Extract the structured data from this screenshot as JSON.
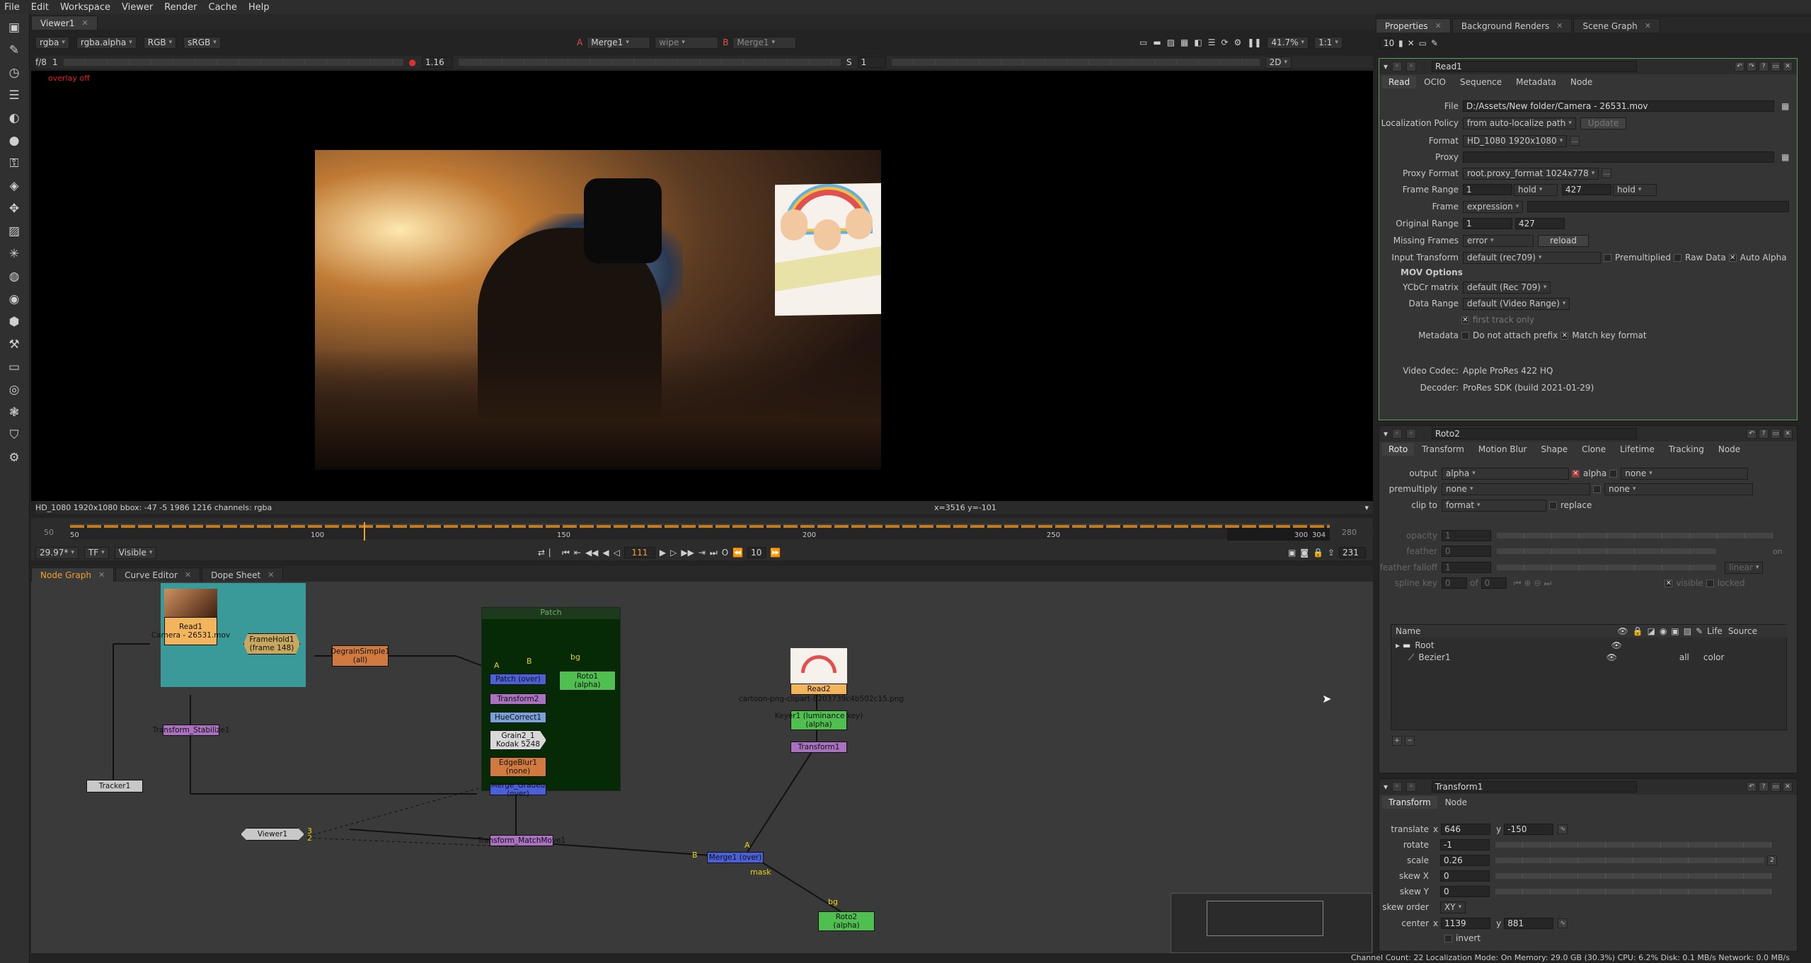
{
  "menu": [
    "File",
    "Edit",
    "Workspace",
    "Viewer",
    "Render",
    "Cache",
    "Help"
  ],
  "viewer": {
    "tab": "Viewer1",
    "channels": "rgba",
    "alpha": "rgba.alpha",
    "colorspace_rgb": "RGB",
    "display": "sRGB",
    "input_a_label": "A",
    "input_a": "Merge1",
    "wipe": "wipe",
    "input_b_label": "B",
    "input_b": "Merge1",
    "zoom": "41.7%",
    "ratio": "1:1",
    "fstop": "f/8",
    "frame_ind": "1",
    "gain": "1.16",
    "s_label": "S",
    "s_value": "1",
    "view_mode": "2D",
    "overlay": "overlay off",
    "info_left": "HD_1080 1920x1080  bbox: -47 -5 1986 1216 channels: rgba",
    "info_coords": "x=3516 y=-101",
    "viewer_label_1": "Camera - 26531.mov"
  },
  "timeline": {
    "start": "50",
    "end": "280",
    "ticks": [
      "50",
      "100",
      "150",
      "200",
      "250",
      "300",
      "304"
    ],
    "current": "111",
    "fps": "29.97*",
    "tf": "TF",
    "visible": "Visible",
    "increment": "10",
    "end_frame": "231"
  },
  "nodegraph": {
    "tabs": [
      "Node Graph",
      "Curve Editor",
      "Dope Sheet"
    ],
    "nodes": {
      "read1": "Read1\nCamera - 26531.mov",
      "framehold": "FrameHold1\n(frame 148)",
      "degrain": "DegrainSimple1\n(all)",
      "patch_label": "Patch",
      "bg_label": "bg",
      "patch": "Patch (over)",
      "transform2": "Transform2",
      "huecorrect": "HueCorrect1",
      "grain": "Grain2_1\nKodak 5248",
      "edgeblur": "EdgeBlur1\n(none)",
      "merge_graded": "Merge_Graded (over)",
      "roto1": "Roto1\n(alpha)",
      "stabilize": "Transform_Stabilize1",
      "tracker": "Tracker1",
      "viewer1": "Viewer1",
      "matchmove": "Transform_MatchMove1",
      "read2": "Read2",
      "read2_file": "cartoon-png-clipart-8203739c4b502c15.png",
      "keyer": "Keyer1 (luminance key)\n(alpha)",
      "transform1": "Transform1",
      "merge1": "Merge1 (over)",
      "mask_label": "mask",
      "bg2_label": "bg",
      "roto2": "Roto2\n(alpha)",
      "input_a": "A",
      "input_b": "B",
      "input_a2": "A",
      "input_b2": "B",
      "viewer_in1": "1",
      "viewer_in2": "2",
      "viewer_in3": "3"
    }
  },
  "status": "Channel Count: 22  Localization Mode: On  Memory: 29.0 GB (30.3%)  CPU: 6.2%  Disk: 0.1 MB/s  Network: 0.0 MB/s",
  "right_tabs": [
    "Properties",
    "Background Renders",
    "Scene Graph"
  ],
  "props_count": "10",
  "read1": {
    "name": "Read1",
    "tabs": [
      "Read",
      "OCIO",
      "Sequence",
      "Metadata",
      "Node"
    ],
    "file_label": "File",
    "file": "D:/Assets/New folder/Camera - 26531.mov",
    "localization_label": "Localization Policy",
    "localization": "from auto-localize path",
    "update": "Update",
    "format_label": "Format",
    "format": "HD_1080 1920x1080",
    "proxy_label": "Proxy",
    "proxy_format_label": "Proxy Format",
    "proxy_format": "root.proxy_format 1024x778",
    "frame_range_label": "Frame Range",
    "frame_start": "1",
    "frame_start_mode": "hold",
    "frame_end": "427",
    "frame_end_mode": "hold",
    "frame_label": "Frame",
    "frame_mode": "expression",
    "orig_range_label": "Original Range",
    "orig_start": "1",
    "orig_end": "427",
    "missing_label": "Missing Frames",
    "missing": "error",
    "reload": "reload",
    "input_transform_label": "Input Transform",
    "input_transform": "default (rec709)",
    "premultiplied": "Premultiplied",
    "raw_data": "Raw Data",
    "auto_alpha": "Auto Alpha",
    "mov_options": "MOV Options",
    "ycbcr_label": "YCbCr matrix",
    "ycbcr": "default (Rec 709)",
    "data_range_label": "Data Range",
    "data_range": "default (Video Range)",
    "first_track": "first track only",
    "metadata_label": "Metadata",
    "no_prefix": "Do not attach prefix",
    "match_key": "Match key format",
    "codec_label": "Video Codec:",
    "codec": "Apple ProRes 422 HQ",
    "decoder_label": "Decoder:",
    "decoder": "ProRes SDK (build 2021-01-29)"
  },
  "roto2": {
    "name": "Roto2",
    "tabs": [
      "Roto",
      "Transform",
      "Motion Blur",
      "Shape",
      "Clone",
      "Lifetime",
      "Tracking",
      "Node"
    ],
    "output_label": "output",
    "output": "alpha",
    "output_alpha": "alpha",
    "output_none": "none",
    "premult_label": "premultiply",
    "premult": "none",
    "premult_none": "none",
    "clip_label": "clip to",
    "clip": "format",
    "replace": "replace",
    "opacity_label": "opacity",
    "opacity": "1",
    "feather_label": "feather",
    "feather": "0",
    "falloff_label": "feather falloff",
    "falloff": "1",
    "falloff_mode": "linear",
    "spline_label": "spline key",
    "spline_key": "0",
    "spline_of": "of",
    "spline_total": "0",
    "visible": "visible",
    "locked": "locked",
    "on": "on",
    "tree_cols": [
      "Name",
      "Life",
      "Source"
    ],
    "tree_root": "Root",
    "tree_bezier": "Bezier1",
    "bezier_life": "all",
    "bezier_source": "color",
    "add": "+",
    "remove": "−"
  },
  "transform1": {
    "name": "Transform1",
    "tabs": [
      "Transform",
      "Node"
    ],
    "translate_label": "translate",
    "x_label": "x",
    "tx": "646",
    "y_label": "y",
    "ty": "-150",
    "rotate_label": "rotate",
    "rotate": "-1",
    "scale_label": "scale",
    "scale": "0.26",
    "scale_ch": "2",
    "skewx_label": "skew X",
    "skewx": "0",
    "skewy_label": "skew Y",
    "skewy": "0",
    "skew_order_label": "skew order",
    "skew_order": "XY",
    "center_label": "center",
    "cx": "1139",
    "cy": "881",
    "invert": "invert"
  },
  "colors": {
    "accent": "#f0a030",
    "read_node": "#f3b55c",
    "roto_node": "#4fbf4f",
    "transform_node": "#a971c0",
    "merge_node": "#4b5fd6",
    "backdrop_teal": "#3a9a9a",
    "backdrop_green": "#062a06"
  }
}
